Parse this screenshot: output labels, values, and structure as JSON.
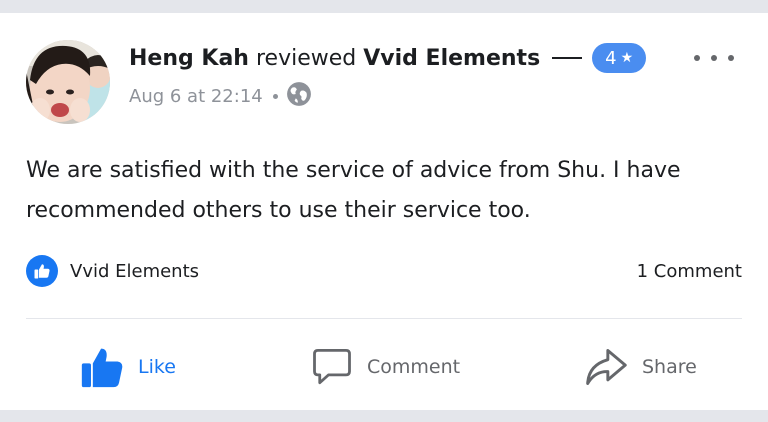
{
  "post": {
    "author": "Heng Kah",
    "verb": "reviewed",
    "page": "Vvid Elements",
    "rating": "4",
    "date": "Aug 6 at 22:14",
    "text": "We are satisfied with the service of advice from Shu. I have recommended others to use their service too.",
    "icons": {
      "privacy": "globe-icon",
      "rating": "star-icon",
      "more": "more-dots-icon"
    }
  },
  "reactions": {
    "label": "Vvid Elements",
    "icon": "thumbs-up-icon",
    "comments": "1 Comment"
  },
  "actions": {
    "like": "Like",
    "comment": "Comment",
    "share": "Share"
  },
  "colors": {
    "accent": "#1877f2",
    "badge": "#4a8df0",
    "text": "#1c1e21",
    "muted": "#65676b"
  }
}
